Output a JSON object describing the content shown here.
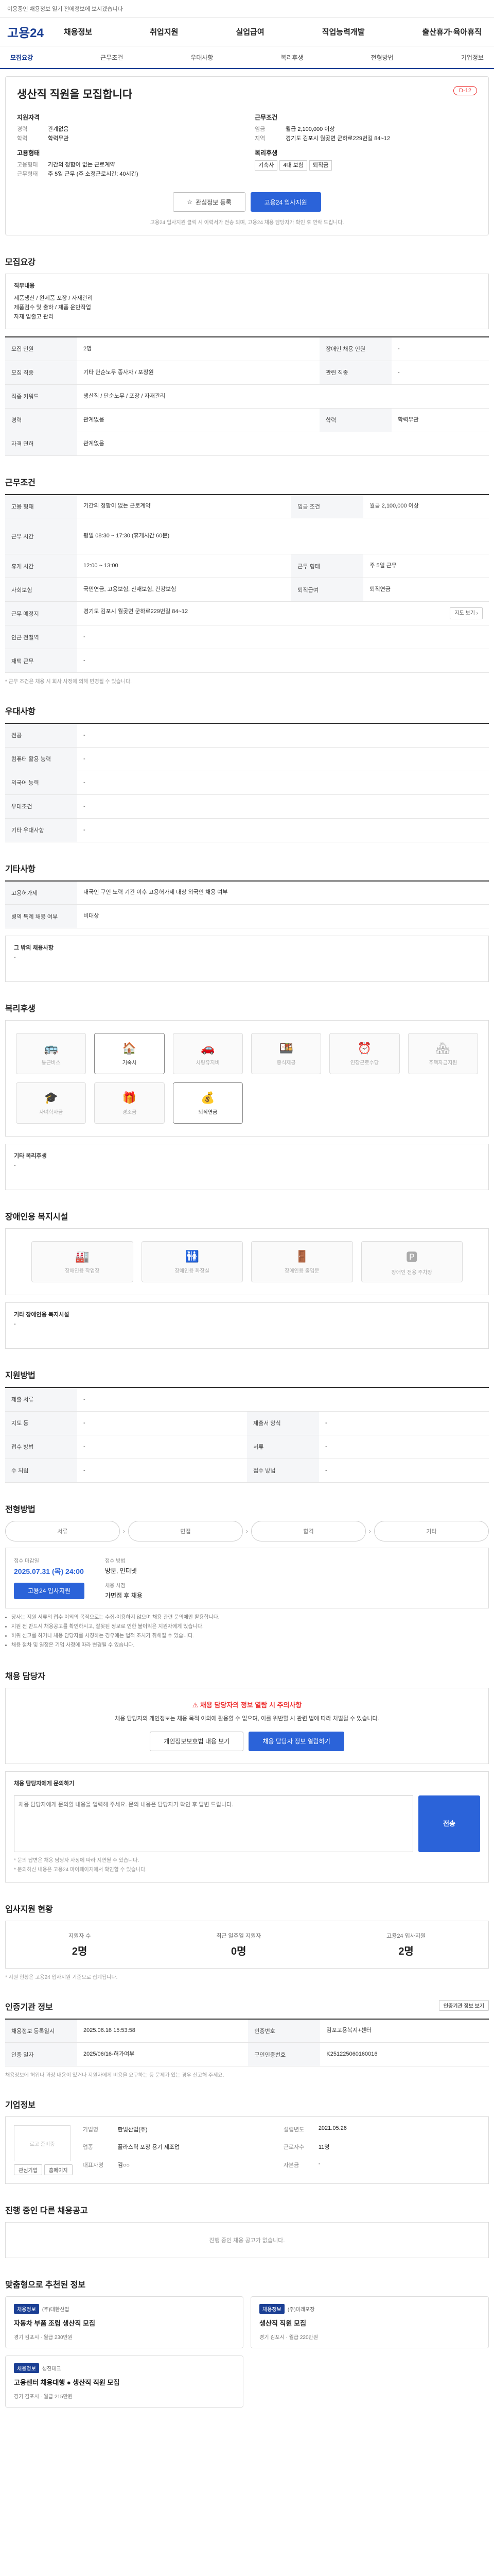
{
  "topbar": {
    "text": "이용중인 채용정보 열기 전에정보에 보시겠습니다"
  },
  "header": {
    "logo": "고용24",
    "nav": [
      "채용정보",
      "취업지원",
      "실업급여",
      "직업능력개발",
      "출산휴가·육아휴직"
    ]
  },
  "subnav": {
    "items": [
      "모집요강",
      "근무조건",
      "우대사항",
      "복리후생",
      "전형방법",
      "기업정보"
    ],
    "active": 0
  },
  "post": {
    "title": "생산직 직원을 모집합니다",
    "dday": "D-12",
    "qualify_h": "지원자격",
    "career_k": "경력",
    "career_v": "관계없음",
    "edu_k": "학력",
    "edu_v": "학력무관",
    "cond_h": "근무조건",
    "pay_k": "임금",
    "pay_v": "월급 2,100,000 이상",
    "reg_k": "지역",
    "reg_v": "경기도 김포시 월곶면 군하로229번길 84~12",
    "form_h": "고용형태",
    "form_k": "고용형태",
    "form_v": "기간의 정함이 없는 근로계약",
    "time_k": "근무형태",
    "time_v": "주 5일 근무 (주 소정근로시간: 40시간)",
    "welf_h": "복리후생",
    "welf_tags": [
      "기숙사",
      "4대 보험",
      "퇴직금"
    ],
    "btn_save": "관심정보 등록",
    "btn_apply": "고용24 입사지원",
    "note": "고용24 입사지원 클릭 시 이력서가 전송 되며, 고용24 채용 담당자가 확인 후 연락 드립니다."
  },
  "recruit": {
    "title": "모집요강",
    "desc_h": "직무내용",
    "desc_lines": [
      "제품생산 / 완제품 포장 / 자재관리",
      "제품검수 및 출하 / 제품 운반작업",
      "자재 입출고 관리"
    ],
    "rows": [
      {
        "k1": "모집 인원",
        "v1": "2명",
        "k2": "장애인 채용 인원",
        "v2": "-"
      },
      {
        "k1": "모집 직종",
        "v1": "기타 단순노무 종사자 / 포장원",
        "k2": "관련 직종",
        "v2": "-"
      },
      {
        "k1": "직종 키워드",
        "v1": "생산직 / 단순노무 / 포장 / 자재관리",
        "k2": "",
        "v2": ""
      },
      {
        "k1": "경력",
        "v1": "관계없음",
        "k2": "학력",
        "v2": "학력무관"
      },
      {
        "k1": "자격 면허",
        "v1": "관계없음",
        "k2": "",
        "v2": ""
      }
    ]
  },
  "work": {
    "title": "근무조건",
    "rows": [
      {
        "k1": "고용 형태",
        "v1": "기간의 정함이 없는 근로계약",
        "k2": "임금 조건",
        "v2": "월급 2,100,000 이상"
      },
      {
        "k1": "근무 시간",
        "v1": "평일 08:30 ~ 17:30 (휴게시간 60분)",
        "k2": "",
        "v2": ""
      },
      {
        "k1": "휴게 시간",
        "v1": "12:00 ~ 13:00",
        "k2": "근무 형태",
        "v2": "주 5일 근무"
      },
      {
        "k1": "사회보험",
        "v1": "국민연금, 고용보험, 산재보험, 건강보험",
        "k2": "퇴직급여",
        "v2": "퇴직연금"
      },
      {
        "k1": "근무 예정지",
        "v1": "경기도 김포시 월곶면 군하로229번길 84~12",
        "k2": "",
        "v2": ""
      },
      {
        "k1": "인근 전철역",
        "v1": "-",
        "k2": "",
        "v2": ""
      },
      {
        "k1": "재택 근무",
        "v1": "-",
        "k2": "",
        "v2": ""
      }
    ],
    "note": "* 근무 조건은 채용 시 회사 사정에 의해 변경될 수 있습니다."
  },
  "pref": {
    "title": "우대사항",
    "rows": [
      {
        "k": "전공",
        "v": "-"
      },
      {
        "k": "컴퓨터 활용 능력",
        "v": "-"
      },
      {
        "k": "외국어 능력",
        "v": "-"
      },
      {
        "k": "우대조건",
        "v": "-"
      },
      {
        "k": "기타 우대사항",
        "v": "-"
      }
    ]
  },
  "extra": {
    "title": "기타사항",
    "rows": [
      {
        "k": "고용허가제",
        "v": "내국인 구인 노력 기간 이후 고용허가제 대상 외국인 채용 여부"
      },
      {
        "k": "병역 특례 채용 여부",
        "v": "비대상"
      }
    ],
    "other_h": "그 밖의 채용사항",
    "other_v": "-"
  },
  "welfare": {
    "title": "복리후생",
    "items": [
      {
        "label": "통근버스",
        "on": false,
        "icon": "bus-icon"
      },
      {
        "label": "기숙사",
        "on": true,
        "icon": "dormitory-icon"
      },
      {
        "label": "차량유지비",
        "on": false,
        "icon": "car-icon"
      },
      {
        "label": "중식제공",
        "on": false,
        "icon": "meal-icon"
      },
      {
        "label": "연장근로수당",
        "on": false,
        "icon": "overtime-icon"
      },
      {
        "label": "주택자금지원",
        "on": false,
        "icon": "house-icon"
      },
      {
        "label": "자녀학자금",
        "on": false,
        "icon": "school-icon"
      },
      {
        "label": "경조금",
        "on": false,
        "icon": "gift-icon"
      },
      {
        "label": "퇴직연금",
        "on": true,
        "icon": "pension-icon"
      }
    ],
    "other_h": "기타 복리후생",
    "other_v": "-"
  },
  "disabled": {
    "title": "장애인용 복지시설",
    "items": [
      "장애인용 작업장",
      "장애인용 화장실",
      "장애인용 출입문",
      "장애인 전용 주차장"
    ],
    "other_h": "기타 장애인용 복지시설",
    "other_v": "-"
  },
  "support": {
    "title": "지원방법",
    "rows": [
      {
        "k1": "제출 서류",
        "v1": "-",
        "k2": "",
        "v2": ""
      },
      {
        "k1": "지도 등",
        "v1": "-",
        "k2": "제출서 양식",
        "v2": "-"
      },
      {
        "k1": "접수 방법",
        "v1": "-",
        "k2": "서류",
        "v2": "-"
      },
      {
        "k1": "수 처럼",
        "v1": "-",
        "k2": "접수 방법",
        "v2": "-"
      }
    ]
  },
  "process": {
    "title": "전형방법",
    "steps": [
      "서류",
      "면접",
      "합격",
      "기타"
    ],
    "deadline_k": "접수 마감일",
    "deadline_v": "2025.07.31 (목) 24:00",
    "method_k": "접수 방법",
    "method_v": "방문, 인터넷",
    "apply_btn": "고용24 입사지원",
    "result_k": "채용 시점",
    "result_v": "가면접 후 채용",
    "bullets": [
      "당사는 지원 서류의 접수 이외의 목적으로는 수집·이용하지 않으며 채용 관련 문의에만 활용합니다.",
      "지원 전 반드시 채용공고를 확인하시고, 잘못된 정보로 인한 불이익은 지원자에게 있습니다.",
      "허위 신고를 하거나 채용 담당자를 사칭하는 경우에는 법적 조치가 취해질 수 있습니다.",
      "채용 절차 및 일정은 기업 사정에 따라 변경될 수 있습니다."
    ]
  },
  "contact": {
    "title": "채용 담당자",
    "warn_title": "채용 담당자의 정보 열람 시 주의사항",
    "warn_body": "채용 담당자의 개인정보는 채용 목적 이외에 활용할 수 없으며, 이를 위반할 시 관련 법에 따라 처벌될 수 있습니다.",
    "btn_agree": "개인정보보호법 내용 보기",
    "btn_view": "채용 담당자 정보 열람하기",
    "qa_h": "채용 담당자에게 문의하기",
    "qa_placeholder": "채용 담당자에게 문의할 내용을 입력해 주세요. 문의 내용은 담당자가 확인 후 답변 드립니다.",
    "qa_btn": "전송",
    "qa_notes": [
      "* 문의 답변은 채용 담당자 사정에 따라 지연될 수 있습니다.",
      "* 문의하신 내용은 고용24 마이페이지에서 확인할 수 있습니다."
    ]
  },
  "stats": {
    "title": "입사지원 현황",
    "items": [
      {
        "lab": "지원자 수",
        "num": "2명"
      },
      {
        "lab": "최근 일주일 지원자",
        "num": "0명"
      },
      {
        "lab": "고용24 입사지원",
        "num": "2명"
      }
    ],
    "note": "* 지원 현황은 고용24 입사지원 기준으로 집계됩니다."
  },
  "agency": {
    "title": "인증기관 정보",
    "btn": "인증기관 정보 보기",
    "rows": [
      {
        "k1": "채용정보 등록일시",
        "v1": "2025.06.16 15:53:58",
        "k2": "인증번호",
        "v2": "김포고용복지+센터"
      },
      {
        "k1": "인증 일자",
        "v1": "2025/06/16-허가여부",
        "k2": "구인인증번호",
        "v2": "K251225060160016"
      }
    ],
    "note": "채용정보에 허위나 과장 내용이 있거나 지원자에게 비용을 요구하는 등 문제가 있는 경우 신고해 주세요."
  },
  "company": {
    "title": "기업정보",
    "logo_alt": "로고 준비중",
    "btn1": "관심기업",
    "btn2": "홈페이지",
    "fields": [
      {
        "k": "기업명",
        "v": "한빛산업(주)"
      },
      {
        "k": "업종",
        "v": "플라스틱 포장 용기 제조업"
      },
      {
        "k": "대표자명",
        "v": "김○○"
      },
      {
        "k": "설립년도",
        "v": "2021.05.26"
      },
      {
        "k": "근로자수",
        "v": "11명"
      },
      {
        "k": "자본금",
        "v": "-"
      }
    ]
  },
  "others": {
    "title": "진행 중인 다른 채용공고",
    "empty": "진행 중인 채용 공고가 없습니다."
  },
  "recommend": {
    "title": "맞춤형으로 추천된 정보",
    "cards": [
      {
        "badge": "채용정보",
        "co": "(주)대한산업",
        "t": "자동차 부품 조립 생산직 모집",
        "meta": "경기 김포시 · 월급 230만원"
      },
      {
        "badge": "채용정보",
        "co": "(주)미래포장",
        "t": "생산직 직원 모집",
        "meta": "경기 김포시 · 월급 220만원"
      },
      {
        "badge": "채용정보",
        "co": "성진테크",
        "t": "고용센터 채용대행 ● 생산직 직원 모집",
        "meta": "경기 김포시 · 월급 215만원"
      }
    ]
  }
}
